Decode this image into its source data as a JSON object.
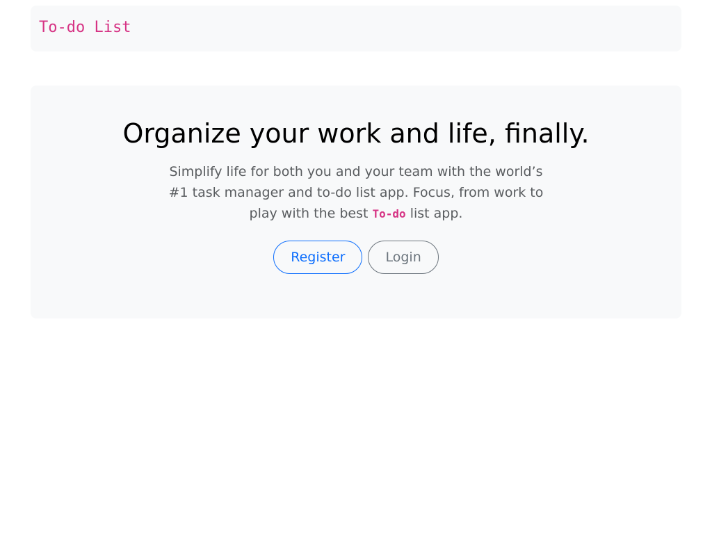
{
  "navbar": {
    "brand": "To-do List"
  },
  "hero": {
    "title": "Organize your work and life, finally.",
    "text_before": "Simplify life for both you and your team with the world’s #1 task manager and to-do list app. Focus, from work to play with the best ",
    "text_code": "To-do",
    "text_after": " list app.",
    "register_label": "Register",
    "login_label": "Login"
  },
  "colors": {
    "brand": "#d63384",
    "primary": "#0d6efd",
    "secondary": "#6c757d",
    "panel": "#f8f9fa"
  }
}
